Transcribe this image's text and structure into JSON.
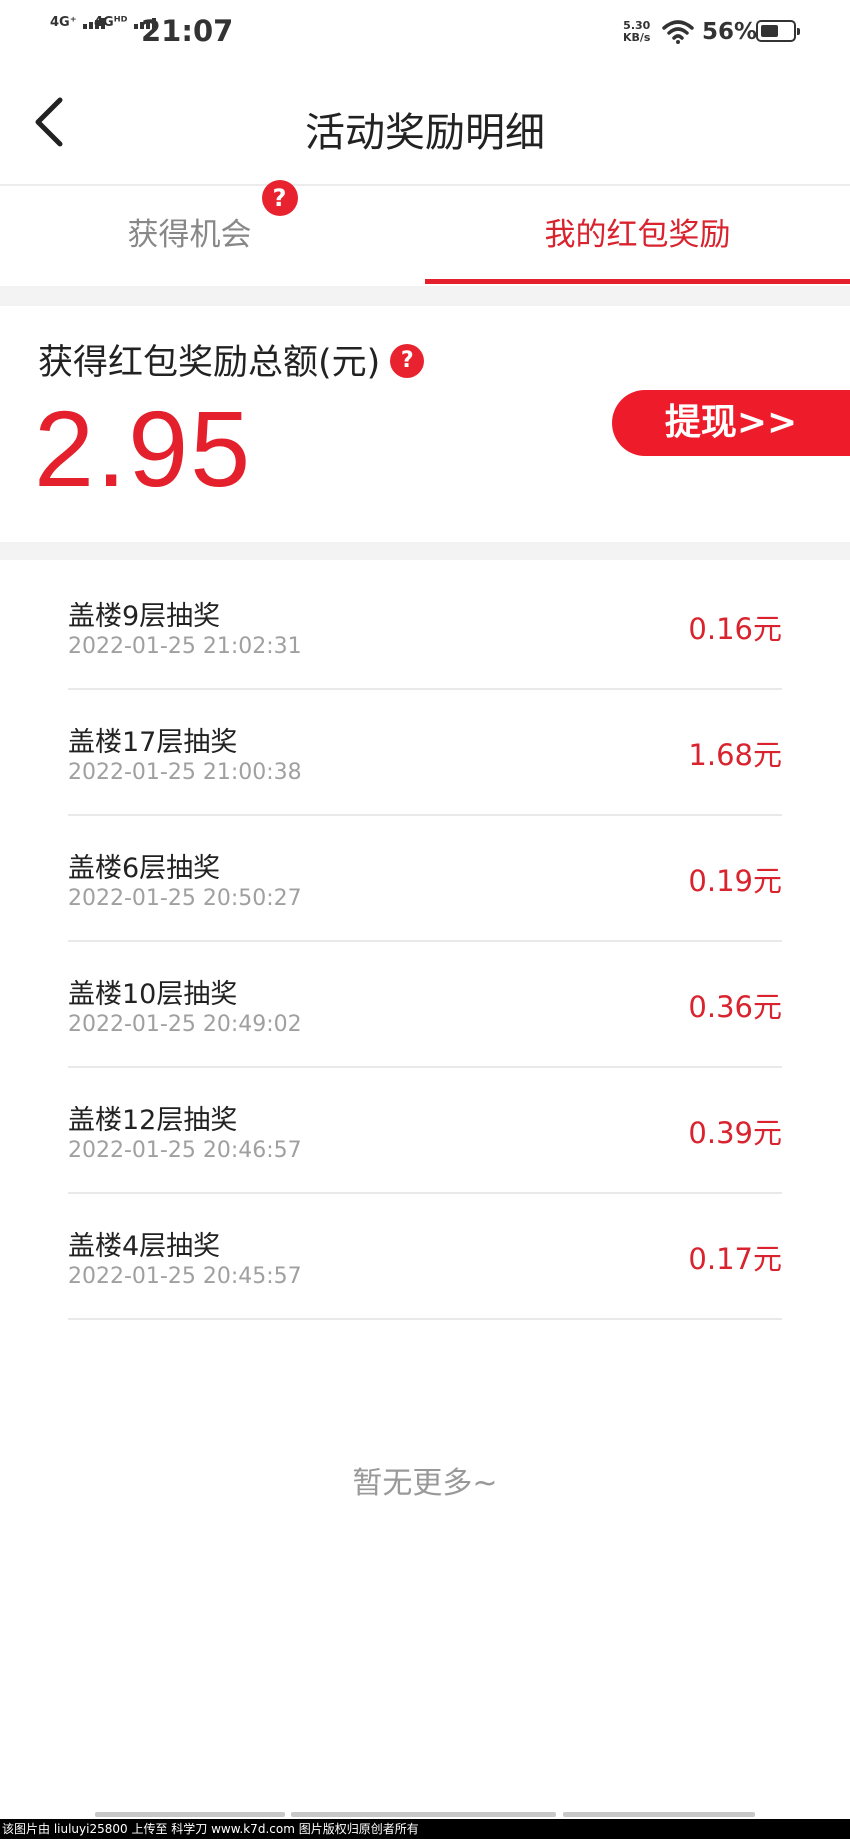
{
  "status_bar": {
    "sig1": "4G⁺",
    "sig2": "4Gᴴᴰ",
    "time": "21:07",
    "speed_value": "5.30",
    "speed_unit": "KB/s",
    "battery": "56%",
    "battery_level": 0.56
  },
  "header": {
    "title": "活动奖励明细",
    "back_icon": "chevron-left-icon"
  },
  "tabs": [
    {
      "label": "获得机会",
      "help": "?"
    },
    {
      "label": "我的红包奖励"
    }
  ],
  "summary": {
    "label": "获得红包奖励总额(元)",
    "help": "?",
    "total": "2.95",
    "withdraw_label": "提现>>"
  },
  "rewards": [
    {
      "title": "盖楼9层抽奖",
      "time": "2022-01-25 21:02:31",
      "amount": "0.16元"
    },
    {
      "title": "盖楼17层抽奖",
      "time": "2022-01-25 21:00:38",
      "amount": "1.68元"
    },
    {
      "title": "盖楼6层抽奖",
      "time": "2022-01-25 20:50:27",
      "amount": "0.19元"
    },
    {
      "title": "盖楼10层抽奖",
      "time": "2022-01-25 20:49:02",
      "amount": "0.36元"
    },
    {
      "title": "盖楼12层抽奖",
      "time": "2022-01-25 20:46:57",
      "amount": "0.39元"
    },
    {
      "title": "盖楼4层抽奖",
      "time": "2022-01-25 20:45:57",
      "amount": "0.17元"
    }
  ],
  "no_more": "暂无更多~",
  "watermark": "该图片由 liuluyi25800 上传至 科学刀 www.k7d.com 图片版权归原创者所有",
  "colors": {
    "accent": "#e3202b",
    "gap": "#f3f3f3",
    "muted": "#a0a0a0"
  }
}
